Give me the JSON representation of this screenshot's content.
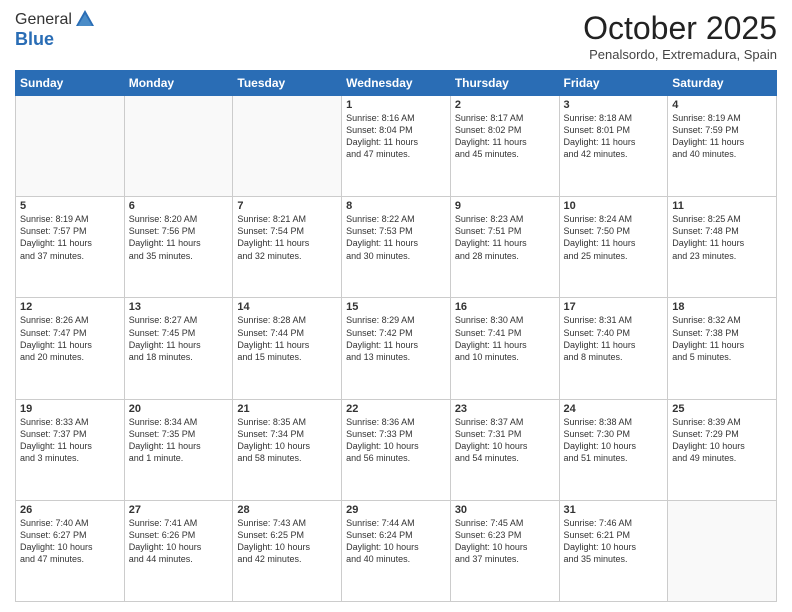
{
  "header": {
    "logo_general": "General",
    "logo_blue": "Blue",
    "month_title": "October 2025",
    "location": "Penalsordo, Extremadura, Spain"
  },
  "weekdays": [
    "Sunday",
    "Monday",
    "Tuesday",
    "Wednesday",
    "Thursday",
    "Friday",
    "Saturday"
  ],
  "weeks": [
    [
      {
        "day": "",
        "content": ""
      },
      {
        "day": "",
        "content": ""
      },
      {
        "day": "",
        "content": ""
      },
      {
        "day": "1",
        "content": "Sunrise: 8:16 AM\nSunset: 8:04 PM\nDaylight: 11 hours\nand 47 minutes."
      },
      {
        "day": "2",
        "content": "Sunrise: 8:17 AM\nSunset: 8:02 PM\nDaylight: 11 hours\nand 45 minutes."
      },
      {
        "day": "3",
        "content": "Sunrise: 8:18 AM\nSunset: 8:01 PM\nDaylight: 11 hours\nand 42 minutes."
      },
      {
        "day": "4",
        "content": "Sunrise: 8:19 AM\nSunset: 7:59 PM\nDaylight: 11 hours\nand 40 minutes."
      }
    ],
    [
      {
        "day": "5",
        "content": "Sunrise: 8:19 AM\nSunset: 7:57 PM\nDaylight: 11 hours\nand 37 minutes."
      },
      {
        "day": "6",
        "content": "Sunrise: 8:20 AM\nSunset: 7:56 PM\nDaylight: 11 hours\nand 35 minutes."
      },
      {
        "day": "7",
        "content": "Sunrise: 8:21 AM\nSunset: 7:54 PM\nDaylight: 11 hours\nand 32 minutes."
      },
      {
        "day": "8",
        "content": "Sunrise: 8:22 AM\nSunset: 7:53 PM\nDaylight: 11 hours\nand 30 minutes."
      },
      {
        "day": "9",
        "content": "Sunrise: 8:23 AM\nSunset: 7:51 PM\nDaylight: 11 hours\nand 28 minutes."
      },
      {
        "day": "10",
        "content": "Sunrise: 8:24 AM\nSunset: 7:50 PM\nDaylight: 11 hours\nand 25 minutes."
      },
      {
        "day": "11",
        "content": "Sunrise: 8:25 AM\nSunset: 7:48 PM\nDaylight: 11 hours\nand 23 minutes."
      }
    ],
    [
      {
        "day": "12",
        "content": "Sunrise: 8:26 AM\nSunset: 7:47 PM\nDaylight: 11 hours\nand 20 minutes."
      },
      {
        "day": "13",
        "content": "Sunrise: 8:27 AM\nSunset: 7:45 PM\nDaylight: 11 hours\nand 18 minutes."
      },
      {
        "day": "14",
        "content": "Sunrise: 8:28 AM\nSunset: 7:44 PM\nDaylight: 11 hours\nand 15 minutes."
      },
      {
        "day": "15",
        "content": "Sunrise: 8:29 AM\nSunset: 7:42 PM\nDaylight: 11 hours\nand 13 minutes."
      },
      {
        "day": "16",
        "content": "Sunrise: 8:30 AM\nSunset: 7:41 PM\nDaylight: 11 hours\nand 10 minutes."
      },
      {
        "day": "17",
        "content": "Sunrise: 8:31 AM\nSunset: 7:40 PM\nDaylight: 11 hours\nand 8 minutes."
      },
      {
        "day": "18",
        "content": "Sunrise: 8:32 AM\nSunset: 7:38 PM\nDaylight: 11 hours\nand 5 minutes."
      }
    ],
    [
      {
        "day": "19",
        "content": "Sunrise: 8:33 AM\nSunset: 7:37 PM\nDaylight: 11 hours\nand 3 minutes."
      },
      {
        "day": "20",
        "content": "Sunrise: 8:34 AM\nSunset: 7:35 PM\nDaylight: 11 hours\nand 1 minute."
      },
      {
        "day": "21",
        "content": "Sunrise: 8:35 AM\nSunset: 7:34 PM\nDaylight: 10 hours\nand 58 minutes."
      },
      {
        "day": "22",
        "content": "Sunrise: 8:36 AM\nSunset: 7:33 PM\nDaylight: 10 hours\nand 56 minutes."
      },
      {
        "day": "23",
        "content": "Sunrise: 8:37 AM\nSunset: 7:31 PM\nDaylight: 10 hours\nand 54 minutes."
      },
      {
        "day": "24",
        "content": "Sunrise: 8:38 AM\nSunset: 7:30 PM\nDaylight: 10 hours\nand 51 minutes."
      },
      {
        "day": "25",
        "content": "Sunrise: 8:39 AM\nSunset: 7:29 PM\nDaylight: 10 hours\nand 49 minutes."
      }
    ],
    [
      {
        "day": "26",
        "content": "Sunrise: 7:40 AM\nSunset: 6:27 PM\nDaylight: 10 hours\nand 47 minutes."
      },
      {
        "day": "27",
        "content": "Sunrise: 7:41 AM\nSunset: 6:26 PM\nDaylight: 10 hours\nand 44 minutes."
      },
      {
        "day": "28",
        "content": "Sunrise: 7:43 AM\nSunset: 6:25 PM\nDaylight: 10 hours\nand 42 minutes."
      },
      {
        "day": "29",
        "content": "Sunrise: 7:44 AM\nSunset: 6:24 PM\nDaylight: 10 hours\nand 40 minutes."
      },
      {
        "day": "30",
        "content": "Sunrise: 7:45 AM\nSunset: 6:23 PM\nDaylight: 10 hours\nand 37 minutes."
      },
      {
        "day": "31",
        "content": "Sunrise: 7:46 AM\nSunset: 6:21 PM\nDaylight: 10 hours\nand 35 minutes."
      },
      {
        "day": "",
        "content": ""
      }
    ]
  ]
}
